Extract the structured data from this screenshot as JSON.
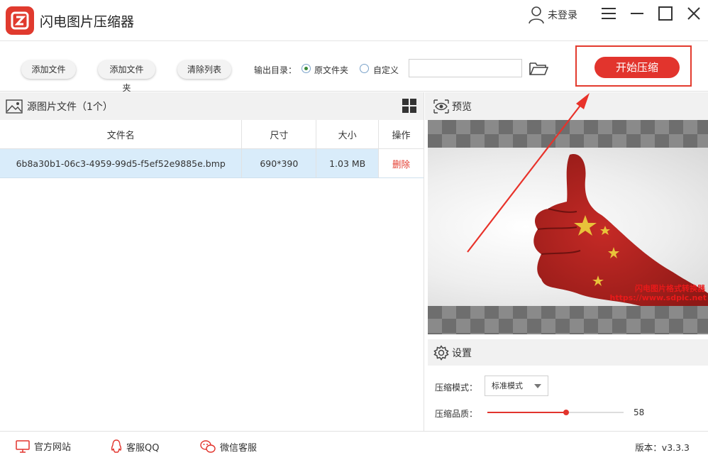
{
  "app": {
    "title": "闪电图片压缩器",
    "user_label": "未登录"
  },
  "toolbar": {
    "add_file": "添加文件",
    "add_folder": "添加文件夹",
    "clear_list": "清除列表",
    "output_label": "输出目录：",
    "option_original": "原文件夹",
    "option_custom": "自定义",
    "output_path": "",
    "start_button": "开始压缩"
  },
  "file_panel": {
    "title": "源图片文件（1个）",
    "columns": [
      "文件名",
      "尺寸",
      "大小",
      "操作"
    ],
    "rows": [
      {
        "name": "6b8a30b1-06c3-4959-99d5-f5ef52e9885e.bmp",
        "size": "690*390",
        "filesize": "1.03 MB",
        "action": "删除"
      }
    ]
  },
  "preview": {
    "title": "预览",
    "watermark_line1": "闪电图片格式转换器",
    "watermark_line2": "https://www.sdpic.net"
  },
  "settings": {
    "title": "设置",
    "mode_label": "压缩模式：",
    "mode_value": "标准模式",
    "quality_label": "压缩品质：",
    "quality_value": "58"
  },
  "footer": {
    "website": "官方网站",
    "qq": "客服QQ",
    "wechat": "微信客服",
    "version": "版本：v3.3.3"
  },
  "colors": {
    "accent": "#e2342d",
    "selected_row": "#d9ecfa"
  }
}
